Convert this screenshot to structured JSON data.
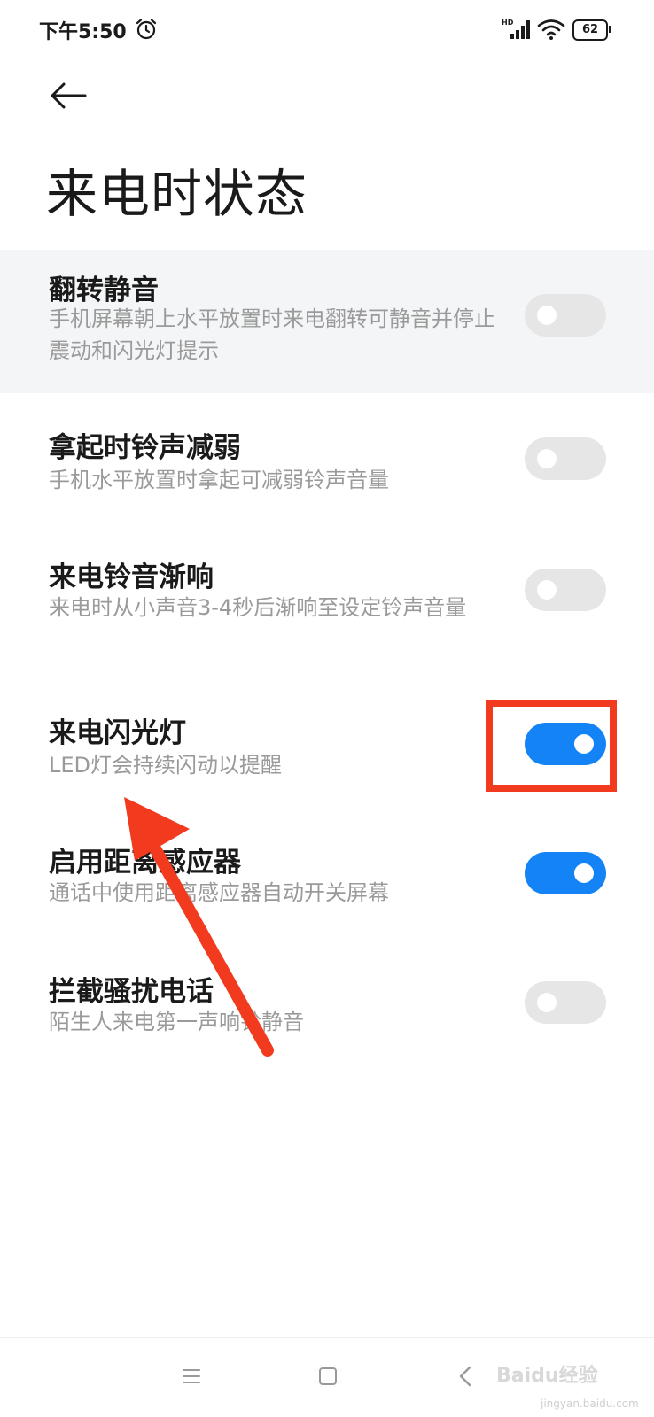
{
  "status_bar": {
    "time": "下午5:50",
    "network_label": "HD",
    "battery_level": "62"
  },
  "header": {
    "title": "来电时状态"
  },
  "settings": [
    {
      "title": "翻转静音",
      "description": "手机屏幕朝上水平放置时来电翻转可静音并停止震动和闪光灯提示",
      "enabled": false
    },
    {
      "title": "拿起时铃声减弱",
      "description": "手机水平放置时拿起可减弱铃声音量",
      "enabled": false
    },
    {
      "title": "来电铃音渐响",
      "description": "来电时从小声音3-4秒后渐响至设定铃声音量",
      "enabled": false
    },
    {
      "title": "来电闪光灯",
      "description": "LED灯会持续闪动以提醒",
      "enabled": true
    },
    {
      "title": "启用距离感应器",
      "description": "通话中使用距离感应器自动开关屏幕",
      "enabled": true
    },
    {
      "title": "拦截骚扰电话",
      "description": "陌生人来电第一声响铃静音",
      "enabled": false
    }
  ],
  "colors": {
    "toggle_on": "#1383f5",
    "toggle_off": "#e6e6e6",
    "annotation_red": "#f23a1f",
    "secondary_text": "#9a9a9a"
  },
  "icons": {
    "back": "arrow-left-icon",
    "alarm": "alarm-clock-icon",
    "signal": "cellular-signal-icon",
    "wifi": "wifi-icon",
    "battery": "battery-icon",
    "nav_menu": "menu-icon",
    "nav_home": "home-square-icon",
    "nav_back": "chevron-left-icon"
  },
  "watermark": {
    "text": "Baidu经验",
    "sub": "jingyan.baidu.com"
  }
}
